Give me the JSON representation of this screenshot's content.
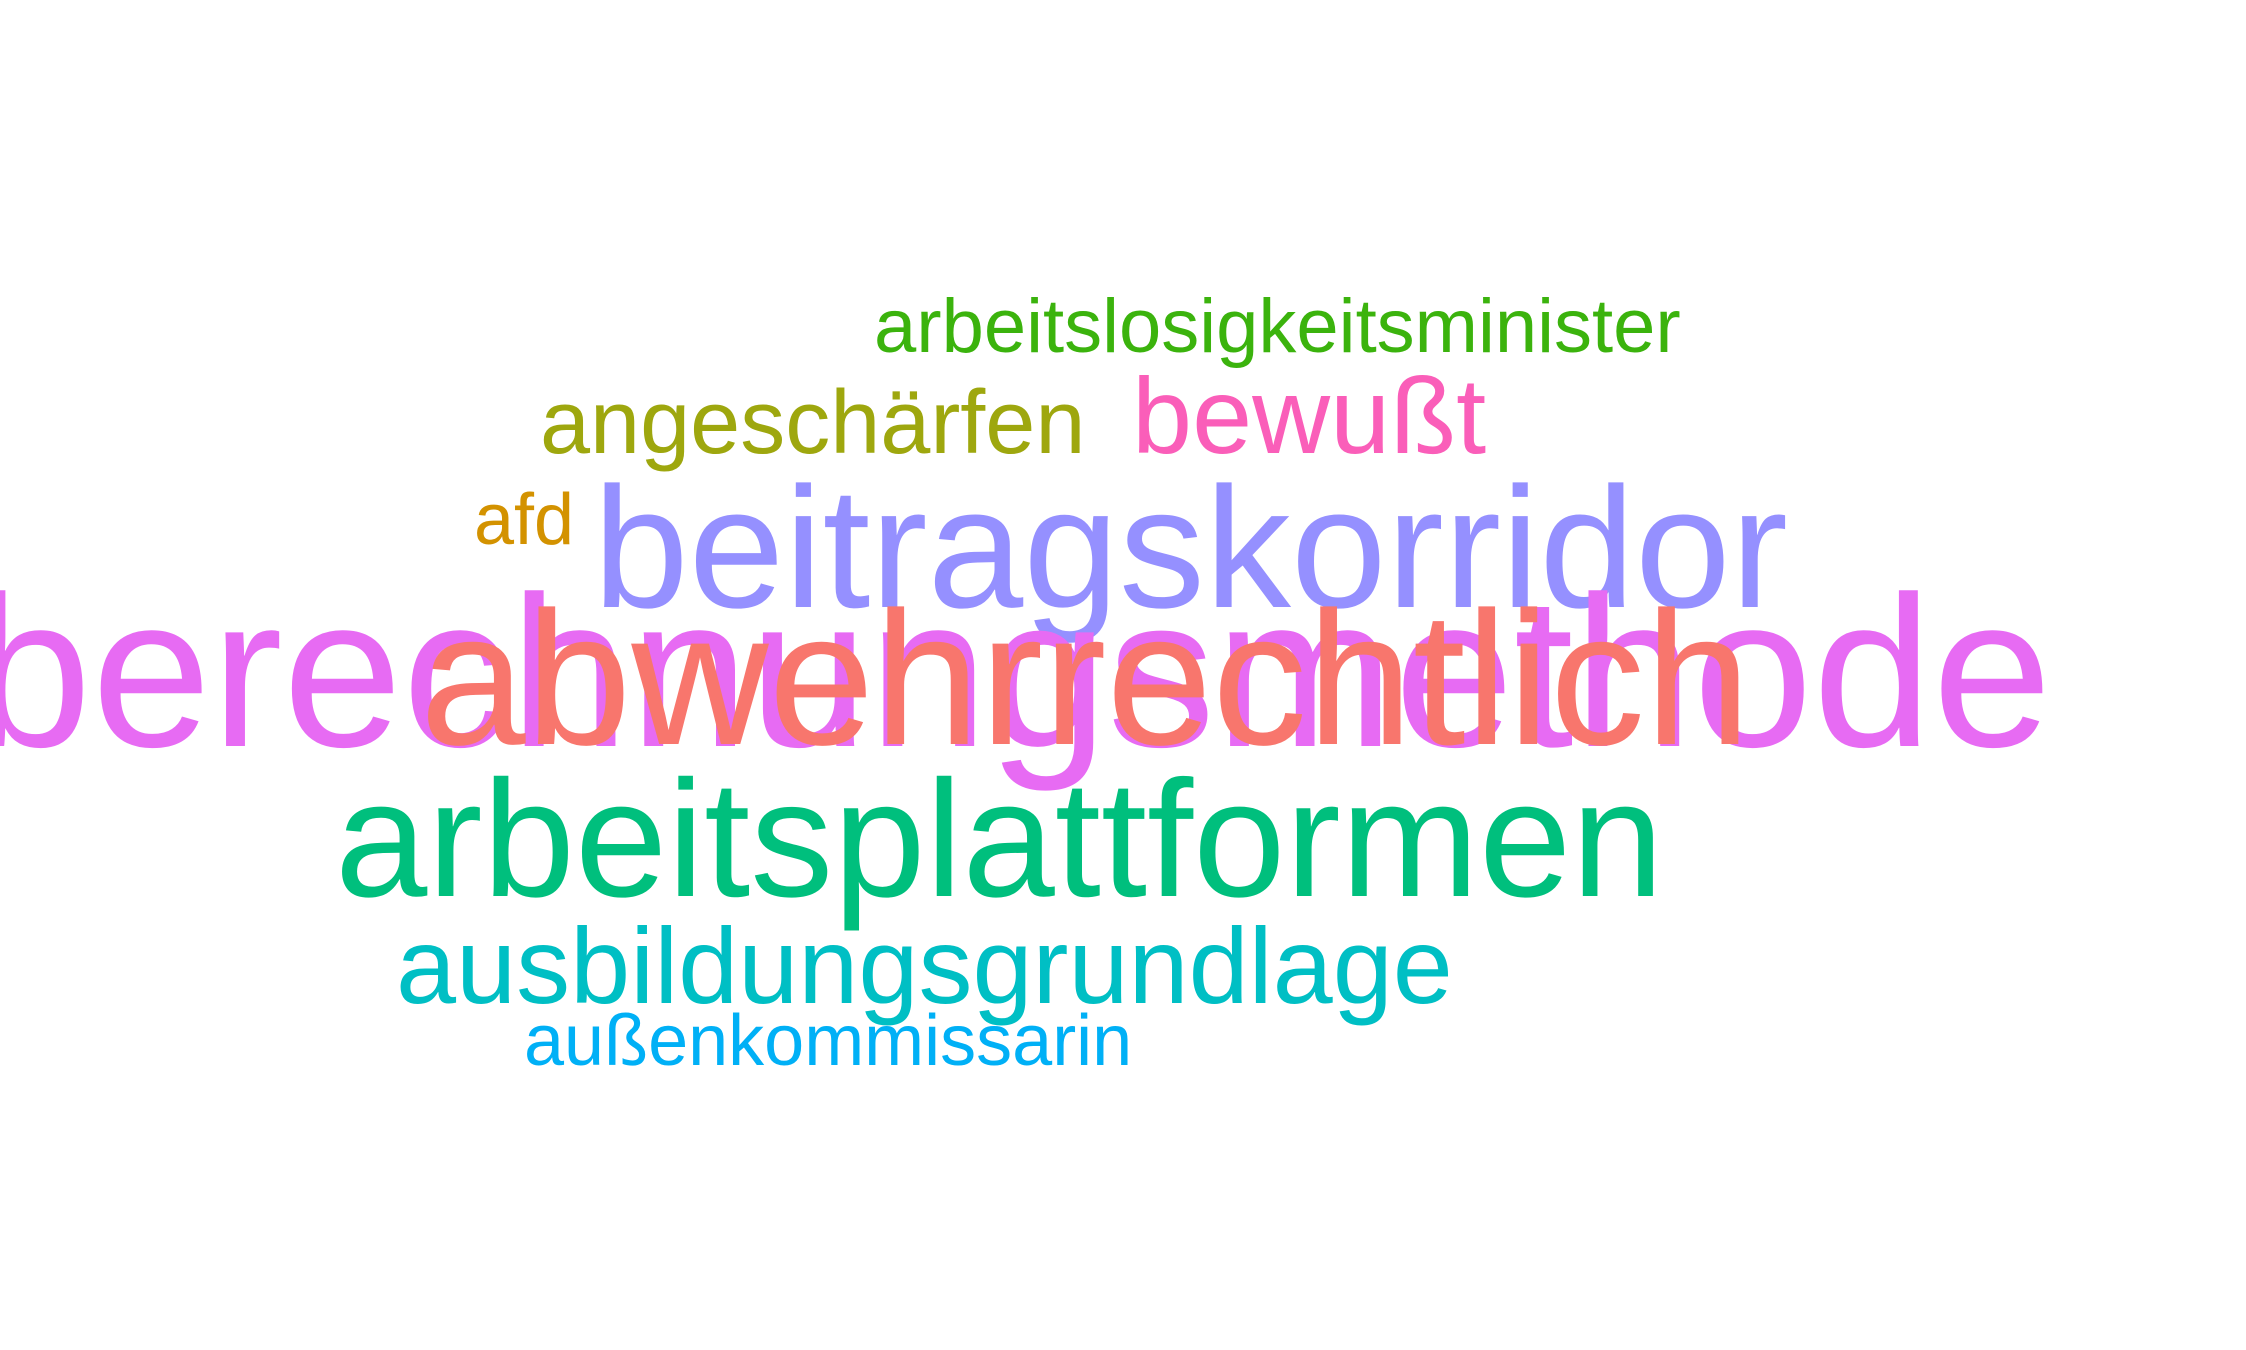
{
  "words": [
    {
      "text": "arbeitslosigkeitsminister",
      "color": "#3BB30D"
    },
    {
      "text": "angeschärfen",
      "color": "#9EA70E"
    },
    {
      "text": "bewußt",
      "color": "#FA5EB9"
    },
    {
      "text": "afd",
      "color": "#D39200"
    },
    {
      "text": "beitragskorridor",
      "color": "#9590FF"
    },
    {
      "text": "berechnungsmethode",
      "color": "#E76BF3"
    },
    {
      "text": "abwehrrechtlich",
      "color": "#F8766D"
    },
    {
      "text": "arbeitsplattformen",
      "color": "#00BF7D"
    },
    {
      "text": "ausbildungsgrundlage",
      "color": "#00BFC4"
    },
    {
      "text": "außenkommissarin",
      "color": "#00B0F6"
    }
  ]
}
